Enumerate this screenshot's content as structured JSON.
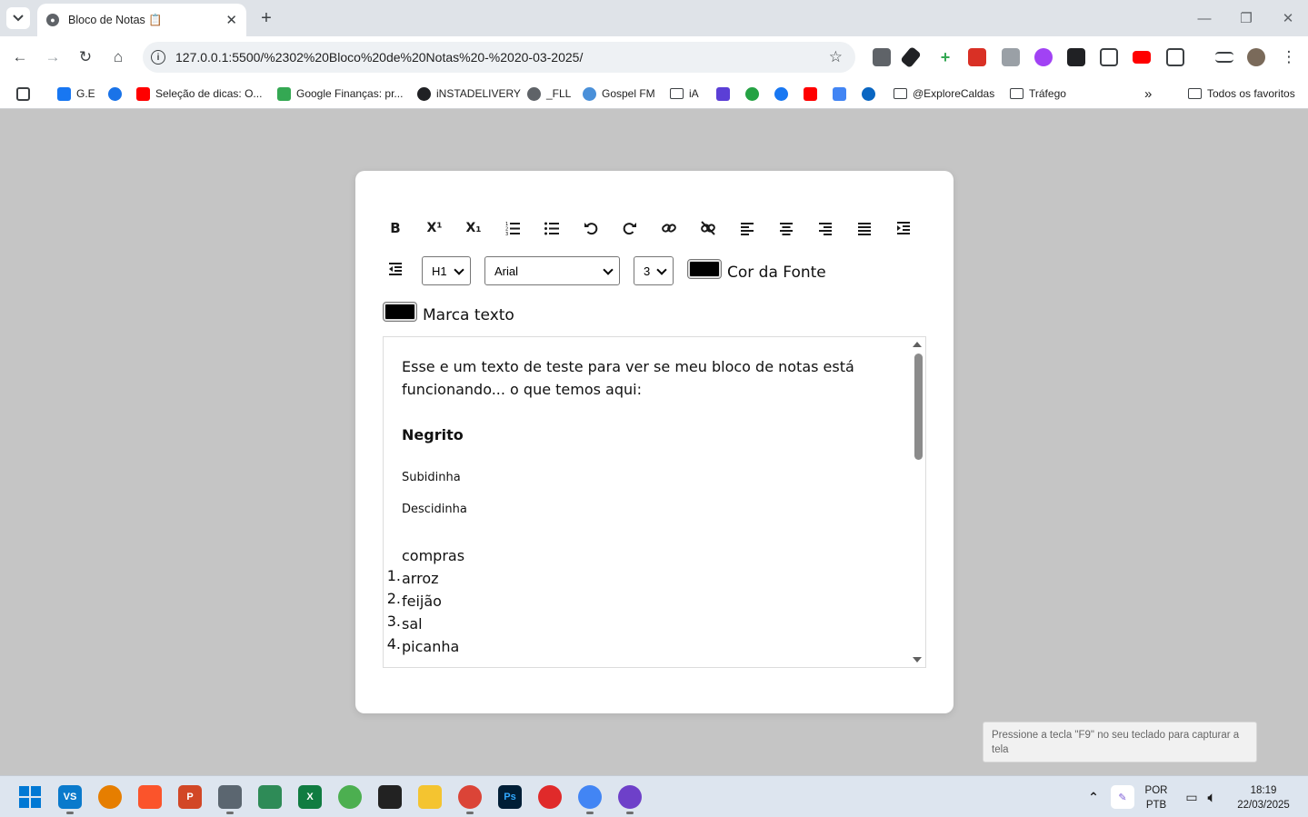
{
  "browser": {
    "tab_title": "Bloco de Notas 📋",
    "url": "127.0.0.1:5500/%2302%20Bloco%20de%20Notas%20-%2020-03-2025/",
    "bookmarks": [
      {
        "label": "G.E",
        "icon": "meta-icon",
        "color": "#1877f2"
      },
      {
        "label": "",
        "icon": "checkmark-app-icon",
        "color": "#1a73e8"
      },
      {
        "label": "Seleção de dicas: O...",
        "icon": "youtube-icon",
        "color": "#ff0000"
      },
      {
        "label": "Google Finanças: pr...",
        "icon": "finance-icon",
        "color": "#34a853"
      },
      {
        "label": "iNSTADELIVERY",
        "icon": "globe-icon",
        "color": "#202124"
      },
      {
        "label": "_FLL",
        "icon": "globe-icon",
        "color": "#5f6368"
      },
      {
        "label": "Gospel FM",
        "icon": "radio-icon",
        "color": "#4a90d9"
      },
      {
        "label": "iA",
        "icon": "folder-icon",
        "color": "#3c4043"
      },
      {
        "label": "@ExploreCaldas",
        "icon": "folder-icon",
        "color": "#3c4043"
      },
      {
        "label": "Tráfego",
        "icon": "folder-icon",
        "color": "#3c4043"
      }
    ],
    "all_bookmarks_label": "Todos os favoritos"
  },
  "editor": {
    "toolbar_buttons": [
      {
        "name": "bold-button",
        "glyph": "B"
      },
      {
        "name": "superscript-button",
        "glyph": "X¹"
      },
      {
        "name": "subscript-button",
        "glyph": "X₁"
      },
      {
        "name": "ordered-list-button",
        "glyph": "ol"
      },
      {
        "name": "unordered-list-button",
        "glyph": "ul"
      },
      {
        "name": "undo-button",
        "glyph": "↺"
      },
      {
        "name": "redo-button",
        "glyph": "↻"
      },
      {
        "name": "link-button",
        "glyph": "link"
      },
      {
        "name": "unlink-button",
        "glyph": "unlink"
      },
      {
        "name": "align-left-button",
        "glyph": "al"
      },
      {
        "name": "align-center-button",
        "glyph": "ac"
      },
      {
        "name": "align-right-button",
        "glyph": "ar"
      },
      {
        "name": "justify-button",
        "glyph": "aj"
      },
      {
        "name": "indent-button",
        "glyph": "in"
      }
    ],
    "heading_select": "H1",
    "font_select": "Arial",
    "size_select": "3",
    "font_color_label": "Cor da Fonte",
    "highlight_label": "Marca texto",
    "font_color": "#000000",
    "highlight_color": "#000000"
  },
  "document": {
    "intro": "Esse e um texto de teste para ver se meu bloco de notas está funcionando... o que temos aqui:",
    "bold_line": "Negrito",
    "sup_line": "Subidinha",
    "sub_line": "Descidinha",
    "list_title": "compras",
    "list_items": [
      "arroz",
      "feijão",
      "sal",
      "picanha"
    ]
  },
  "toast": "Pressione a tecla \"F9\" no seu teclado para capturar a tela",
  "taskbar": {
    "lang_top": "POR",
    "lang_bottom": "PTB",
    "time": "18:19",
    "date": "22/03/2025"
  }
}
